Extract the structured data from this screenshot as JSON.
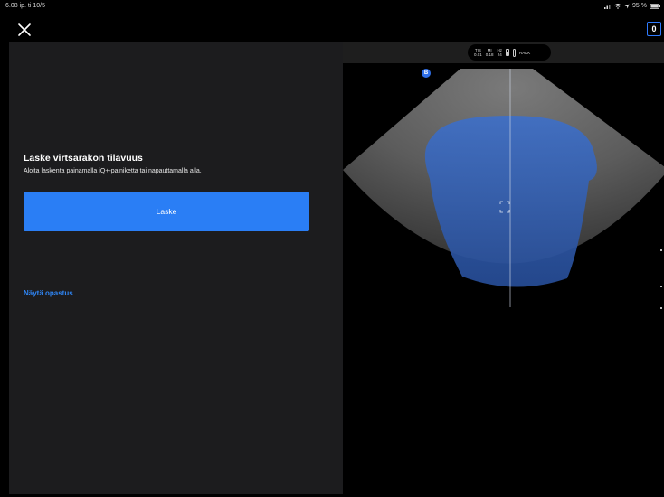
{
  "status_bar": {
    "time": "6.08 ip.  ti 10/5",
    "battery_percent": "95 %"
  },
  "header": {
    "close_icon": "close-icon",
    "count_badge": "0"
  },
  "left_panel": {
    "title": "Laske virtsarakon tilavuus",
    "subtitle": "Aloita laskenta painamalla iQ+-painiketta tai napauttamalla alla.",
    "calculate_button": "Laske",
    "guide_link": "Näytä opastus"
  },
  "imaging": {
    "params": [
      {
        "label": "TIS",
        "value": "0.01"
      },
      {
        "label": "MI",
        "value": "0.18"
      },
      {
        "label": "Hz",
        "value": "24"
      }
    ],
    "mode": "RAKK",
    "marker": "B"
  },
  "colors": {
    "accent": "#2a7ef5",
    "link": "#2f86f6",
    "panel": "#1c1c1e",
    "overlay": "#2c5fc0"
  }
}
